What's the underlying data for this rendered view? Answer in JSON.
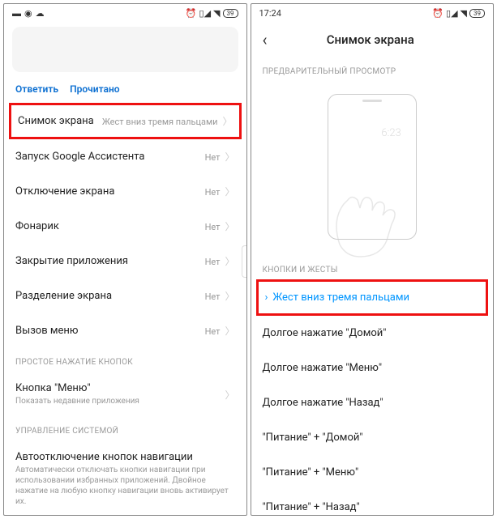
{
  "left": {
    "status": {
      "battery": "39"
    },
    "actions": {
      "reply": "Ответить",
      "read": "Прочитано"
    },
    "items": [
      {
        "label": "Снимок экрана",
        "value": "Жест вниз тремя пальцами",
        "highlight": true
      },
      {
        "label": "Запуск Google Ассистента",
        "value": "Нет"
      },
      {
        "label": "Отключение экрана",
        "value": "Нет"
      },
      {
        "label": "Фонарик",
        "value": "Нет"
      },
      {
        "label": "Закрытие приложения",
        "value": "Нет"
      },
      {
        "label": "Разделение экрана",
        "value": "Нет"
      },
      {
        "label": "Вызов меню",
        "value": "Нет"
      }
    ],
    "section1": "ПРОСТОЕ НАЖАТИЕ КНОПОК",
    "menu_button": {
      "title": "Кнопка \"Меню\"",
      "sub": "Показать недавние приложения"
    },
    "section2": "УПРАВЛЕНИЕ СИСТЕМОЙ",
    "auto_off": {
      "title": "Автоотключение кнопок навигации",
      "sub": "Автоматически отключать кнопки навигации при использовании избранных приложений. Двойное нажатие на любую кнопку навигации вновь активирует их."
    }
  },
  "right": {
    "time": "17:24",
    "status": {
      "battery": "39"
    },
    "title": "Снимок экрана",
    "preview_label": "ПРЕДВАРИТЕЛЬНЫЙ ПРОСМОТР",
    "preview_time": "6:23",
    "section": "КНОПКИ И ЖЕСТЫ",
    "gestures": [
      {
        "label": "Жест вниз тремя пальцами",
        "selected": true,
        "highlight": true
      },
      {
        "label": "Долгое нажатие \"Домой\""
      },
      {
        "label": "Долгое нажатие \"Меню\""
      },
      {
        "label": "Долгое нажатие \"Назад\""
      },
      {
        "label": "\"Питание\" + \"Домой\""
      },
      {
        "label": "\"Питание\" + \"Меню\""
      },
      {
        "label": "\"Питание\" + \"Назад\""
      }
    ]
  }
}
